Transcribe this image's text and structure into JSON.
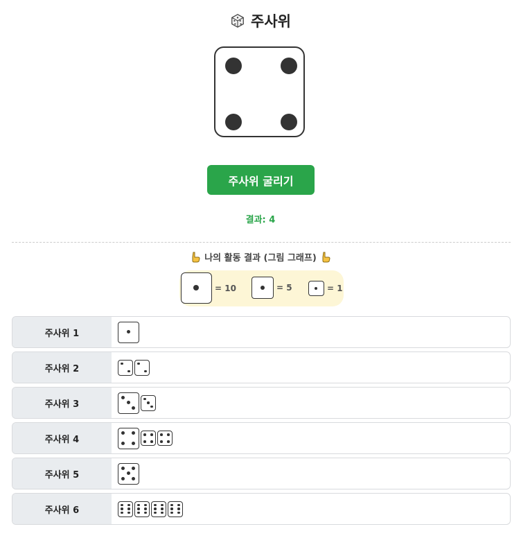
{
  "title": "주사위",
  "big_die_value": 4,
  "roll_button_label": "주사위 굴리기",
  "result_text": "결과: 4",
  "graph_title": "나의 활동 결과 (그림 그래프)",
  "legend": [
    {
      "size": "large",
      "text": "= 10"
    },
    {
      "size": "medium",
      "text": "= 5"
    },
    {
      "size": "small",
      "text": "= 1"
    }
  ],
  "rows": [
    {
      "label": "주사위 1",
      "icons": [
        "medium"
      ]
    },
    {
      "label": "주사위 2",
      "icons": [
        "small",
        "small"
      ]
    },
    {
      "label": "주사위 3",
      "icons": [
        "medium",
        "small"
      ]
    },
    {
      "label": "주사위 4",
      "icons": [
        "medium",
        "small",
        "small"
      ]
    },
    {
      "label": "주사위 5",
      "icons": [
        "medium"
      ]
    },
    {
      "label": "주사위 6",
      "icons": [
        "small",
        "small",
        "small",
        "small"
      ]
    }
  ],
  "colors": {
    "accent": "#2aa54a",
    "legend_bg": "#fdf6d6",
    "label_bg": "#e9ecef"
  }
}
